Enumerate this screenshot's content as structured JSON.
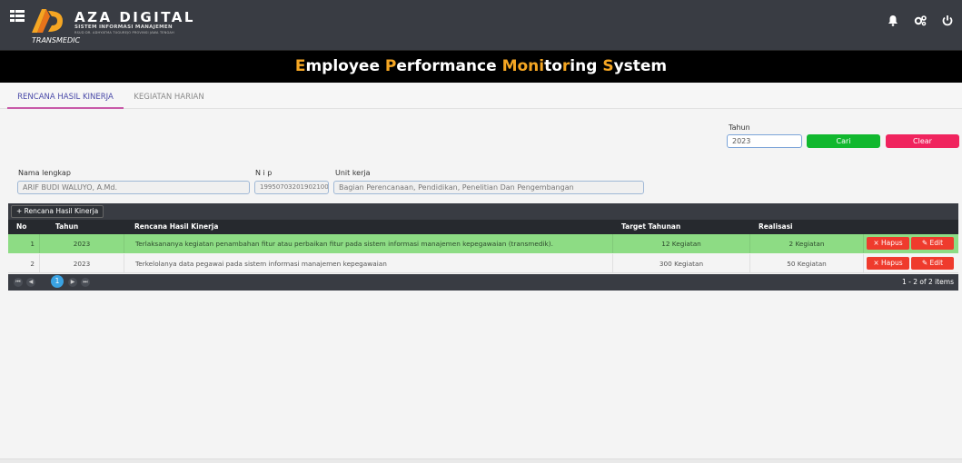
{
  "header": {
    "brand_title": "AZA DIGITAL",
    "brand_subtitle": "SISTEM INFORMASI MANAJEMEN",
    "brand_tagline": "RSUD DR. ADHYATMA TUGUREJO PROVINSI JAWA TENGAH",
    "app_name": "TRANSMEDIC",
    "icons": [
      "menu-icon",
      "bell-icon",
      "gears-icon",
      "power-icon"
    ],
    "colors": {
      "bar": "#393c43",
      "accent": "#f5a623"
    }
  },
  "title_band": {
    "parts": [
      {
        "text": "E",
        "accent": true
      },
      {
        "text": "mployee ",
        "accent": false
      },
      {
        "text": "P",
        "accent": true
      },
      {
        "text": "erformance ",
        "accent": false
      },
      {
        "text": "Moni",
        "accent": true
      },
      {
        "text": "to",
        "accent": false
      },
      {
        "text": "r",
        "accent": true
      },
      {
        "text": "ing ",
        "accent": false
      },
      {
        "text": "S",
        "accent": true
      },
      {
        "text": "ystem",
        "accent": false
      }
    ]
  },
  "tabs": [
    {
      "label": "RENCANA HASIL KINERJA",
      "active": true
    },
    {
      "label": "KEGIATAN HARIAN",
      "active": false
    }
  ],
  "search": {
    "tahun_label": "Tahun",
    "tahun_value": "2023",
    "cari_label": "Cari",
    "clear_label": "Clear"
  },
  "employee": {
    "nama_label": "Nama lengkap",
    "nama_value": "ARIF BUDI WALUYO, A.Md.",
    "nip_label": "N i p",
    "nip_value": "199507032019021003",
    "unit_label": "Unit kerja",
    "unit_value": "Bagian Perencanaan, Pendidikan, Penelitian Dan Pengembangan"
  },
  "grid": {
    "add_label": "+ Rencana Hasil Kinerja",
    "columns": [
      "No",
      "Tahun",
      "Rencana Hasil Kinerja",
      "Target Tahunan",
      "Realisasi"
    ],
    "hapus_label": "× Hapus",
    "edit_label": "✎ Edit",
    "rows": [
      {
        "no": "1",
        "tahun": "2023",
        "rencana": "Terlaksananya kegiatan penambahan fitur atau perbaikan fitur pada sistem informasi manajemen kepegawaian (transmedik).",
        "target": "12 Kegiatan",
        "realisasi": "2 Kegiatan",
        "selected": true
      },
      {
        "no": "2",
        "tahun": "2023",
        "rencana": "Terkelolanya data pegawai pada sistem informasi manajemen kepegawaian",
        "target": "300 Kegiatan",
        "realisasi": "50 Kegiatan",
        "selected": false
      }
    ],
    "pager": {
      "current_page": "1",
      "info": "1 - 2 of 2 items",
      "first": "⏮",
      "prev": "◀",
      "next": "▶",
      "last": "⏭"
    }
  }
}
